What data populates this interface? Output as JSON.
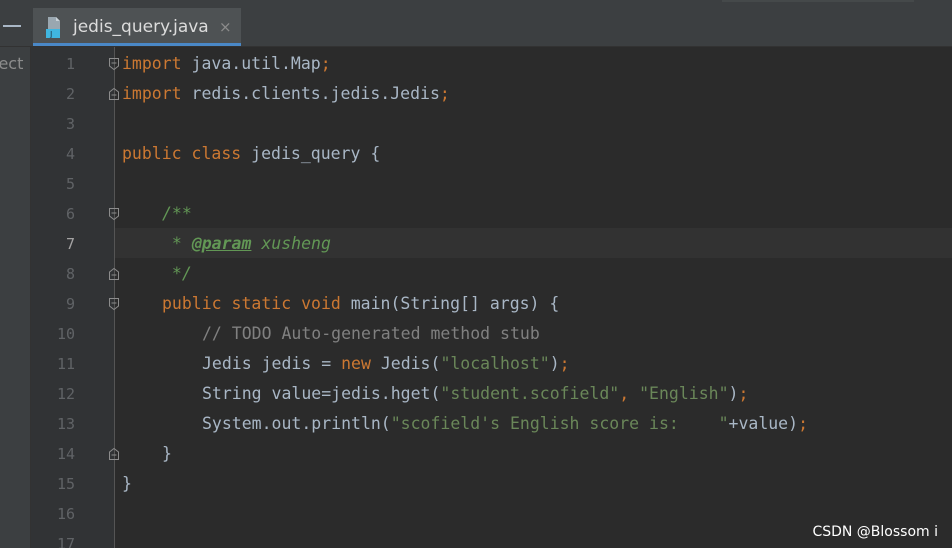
{
  "tab": {
    "label": "jedis_query.java",
    "close": "×"
  },
  "project_panel": {
    "label": "ject"
  },
  "line_numbers": [
    "1",
    "2",
    "3",
    "4",
    "5",
    "6",
    "7",
    "8",
    "9",
    "10",
    "11",
    "12",
    "13",
    "14",
    "15",
    "16",
    "17"
  ],
  "code": {
    "l1": {
      "kw": "import",
      "rest": " java.util.Map",
      "semi": ";"
    },
    "l2": {
      "kw": "import",
      "rest": " redis.clients.jedis.Jedis",
      "semi": ";"
    },
    "l4": {
      "kw": "public class",
      "rest": " jedis_query {"
    },
    "l6": {
      "doc": "/**"
    },
    "l7": {
      "doc": " * ",
      "tag": "@param",
      "param": " xusheng"
    },
    "l8": {
      "doc": " */"
    },
    "l9": {
      "kw": "public static void",
      "rest": " main(String[] args) {"
    },
    "l10": {
      "comment": "// TODO Auto-generated method stub"
    },
    "l11": {
      "pre": "Jedis jedis = ",
      "kw": "new",
      "mid": " Jedis(",
      "str": "\"localhost\"",
      "post": ")",
      "semi": ";"
    },
    "l12": {
      "pre": "String value=jedis.hget(",
      "str1": "\"student.scofield\"",
      "comma": ", ",
      "str2": "\"English\"",
      "post": ")",
      "semi": ";"
    },
    "l13": {
      "pre": "System.out.println(",
      "str": "\"scofield's English score is:    \"",
      "post": "+value)",
      "semi": ";"
    },
    "l14": {
      "text": "}"
    },
    "l15": {
      "text": "}"
    }
  },
  "watermark": "CSDN @Blossom i",
  "colors": {
    "background": "#2b2b2b",
    "keyword": "#cc7832",
    "string": "#6a8759",
    "comment": "#808080",
    "doc": "#629755",
    "text": "#a9b7c6"
  }
}
